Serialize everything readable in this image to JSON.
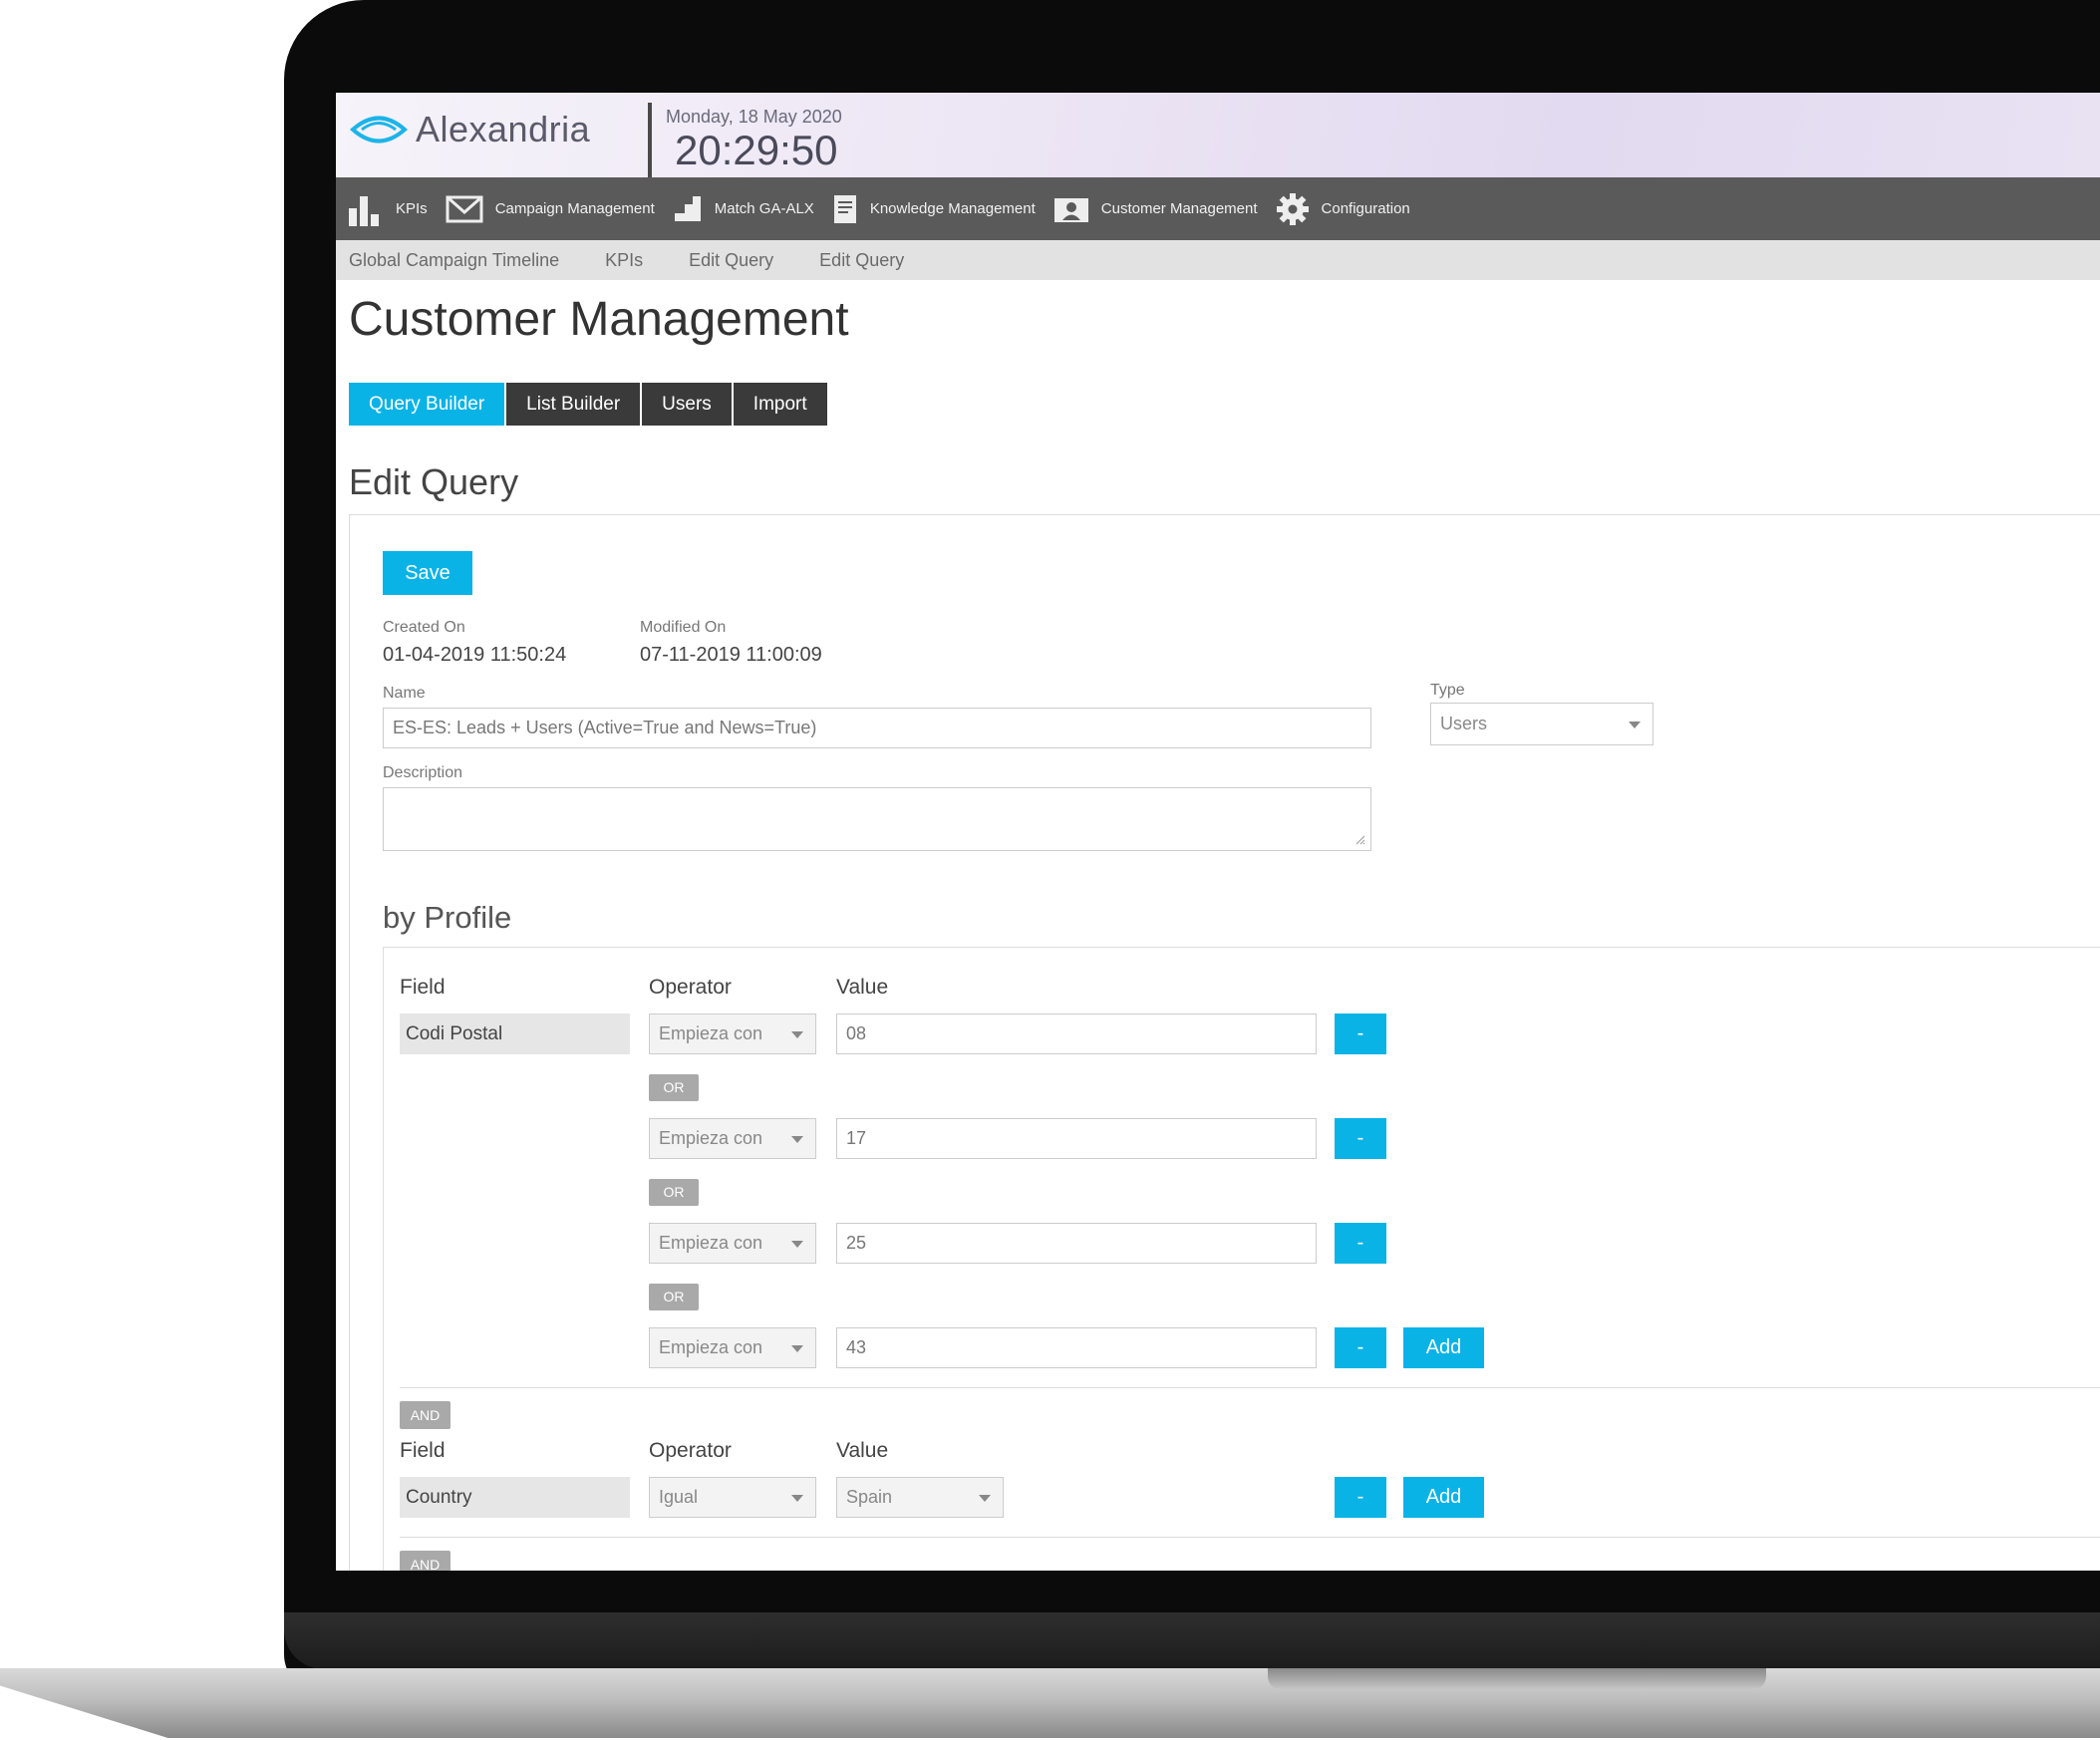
{
  "app": {
    "brand": "Alexandria",
    "date": "Monday, 18 May 2020",
    "time": "20:29:50"
  },
  "main_nav": [
    {
      "label": "KPIs",
      "icon": "bar-chart-icon"
    },
    {
      "label": "Campaign Management",
      "icon": "envelope-icon"
    },
    {
      "label": "Match GA-ALX",
      "icon": "steps-icon"
    },
    {
      "label": "Knowledge Management",
      "icon": "document-icon"
    },
    {
      "label": "Customer Management",
      "icon": "user-card-icon"
    },
    {
      "label": "Configuration",
      "icon": "gear-icon"
    }
  ],
  "breadcrumbs": [
    "Global Campaign Timeline",
    "KPIs",
    "Edit Query",
    "Edit Query"
  ],
  "page_title": "Customer Management",
  "tabs": [
    {
      "label": "Query Builder",
      "active": true
    },
    {
      "label": "List Builder",
      "active": false
    },
    {
      "label": "Users",
      "active": false
    },
    {
      "label": "Import",
      "active": false
    }
  ],
  "section_title": "Edit Query",
  "form": {
    "save_label": "Save",
    "created_on_label": "Created On",
    "created_on": "01-04-2019 11:50:24",
    "modified_on_label": "Modified On",
    "modified_on": "07-11-2019 11:00:09",
    "name_label": "Name",
    "name_value": "ES-ES: Leads + Users (Active=True and News=True)",
    "description_label": "Description",
    "description_value": "",
    "type_label": "Type",
    "type_value": "Users"
  },
  "profile": {
    "title": "by Profile",
    "col_field": "Field",
    "col_operator": "Operator",
    "col_value": "Value",
    "remove_label": "-",
    "add_label": "Add",
    "or_label": "OR",
    "and_label": "AND",
    "group1": {
      "field": "Codi Postal",
      "rows": [
        {
          "operator": "Empieza con",
          "value": "08"
        },
        {
          "operator": "Empieza con",
          "value": "17"
        },
        {
          "operator": "Empieza con",
          "value": "25"
        },
        {
          "operator": "Empieza con",
          "value": "43"
        }
      ]
    },
    "group2": {
      "field": "Country",
      "operator": "Igual",
      "value": "Spain"
    }
  },
  "colors": {
    "accent": "#0ab3e6",
    "nav_bg": "#5a5a5a",
    "tab_bg": "#3a3a3a"
  }
}
